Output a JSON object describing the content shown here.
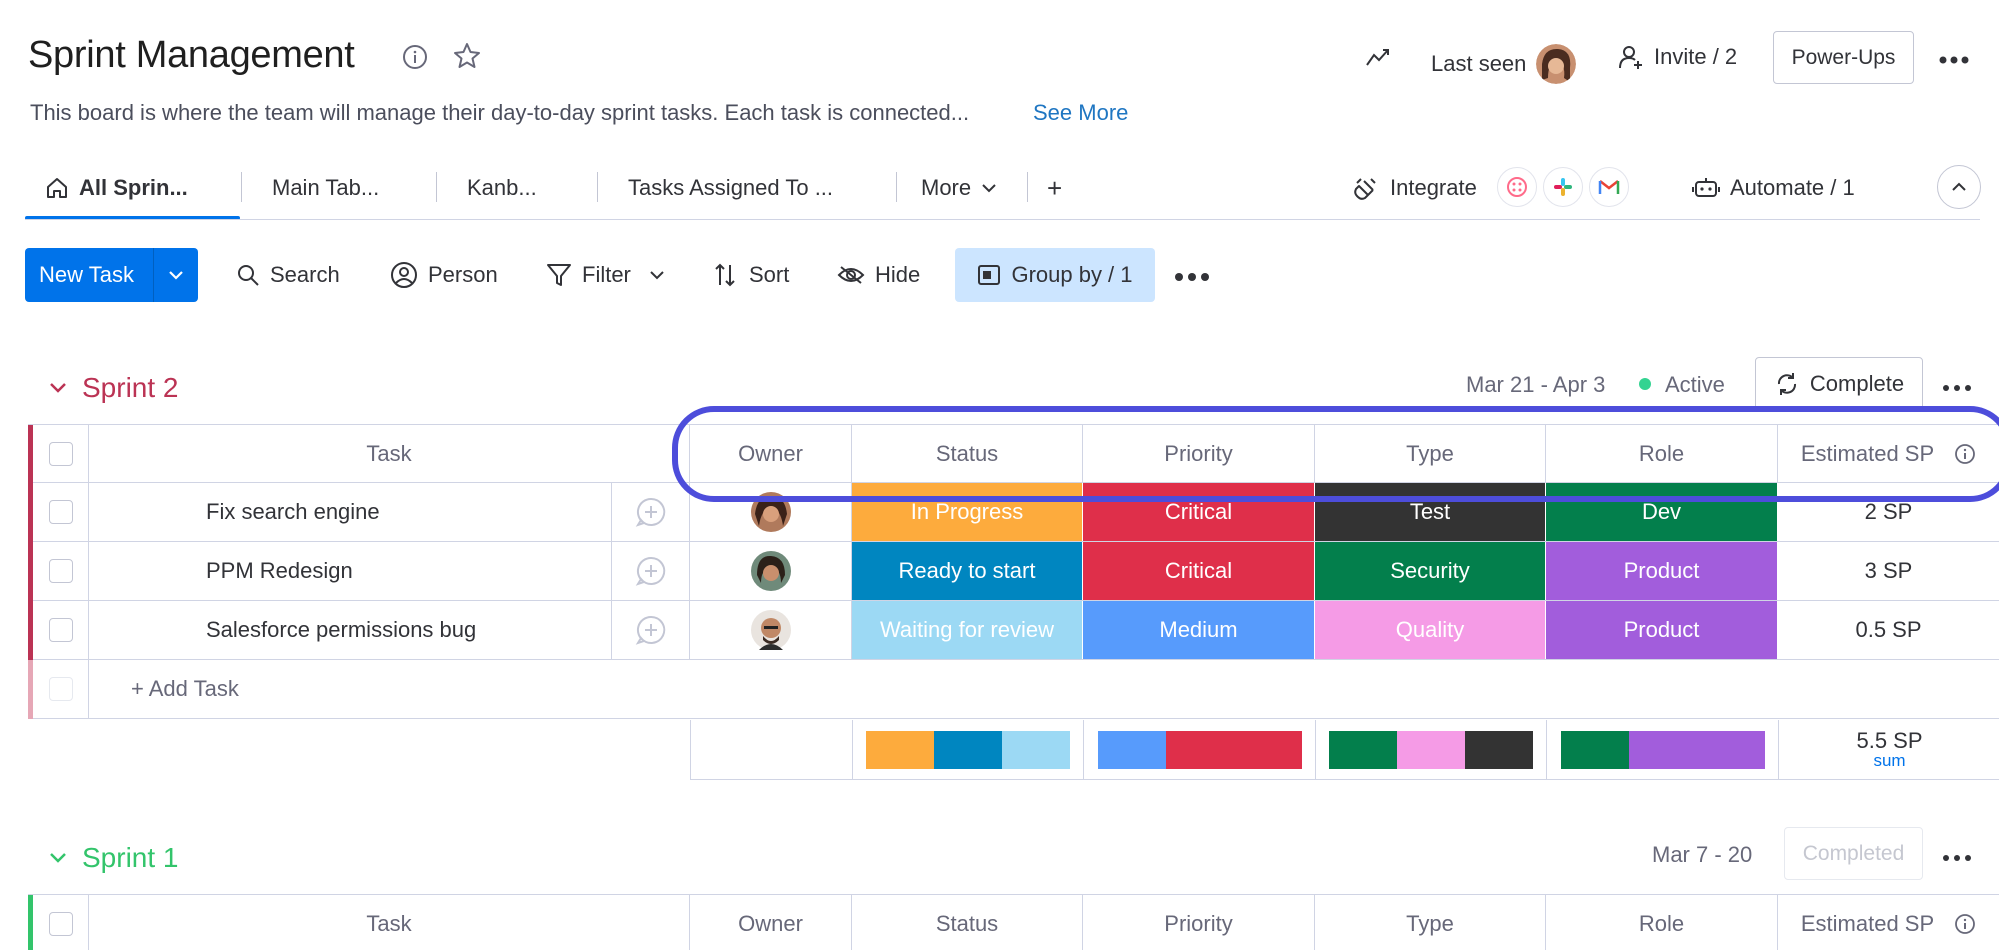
{
  "header": {
    "title": "Sprint Management",
    "description": "This board is where the team will manage their day-to-day sprint tasks. Each task is connected...",
    "see_more": "See More",
    "last_seen": "Last seen",
    "invite": "Invite / 2",
    "power_ups": "Power-Ups"
  },
  "tabs": {
    "items": [
      "All Sprin...",
      "Main Tab...",
      "Kanb...",
      "Tasks Assigned To ...",
      "More"
    ],
    "add": "+",
    "integrate": "Integrate",
    "automate": "Automate / 1"
  },
  "toolbar": {
    "new_task": "New Task",
    "search": "Search",
    "person": "Person",
    "filter": "Filter",
    "sort": "Sort",
    "hide": "Hide",
    "group_by": "Group by / 1"
  },
  "columns": [
    "Task",
    "Owner",
    "Status",
    "Priority",
    "Type",
    "Role",
    "Estimated SP"
  ],
  "groups": [
    {
      "name": "Sprint 2",
      "color": "#bb3354",
      "dates": "Mar 21 - Apr 3",
      "state": "Active",
      "action": "Complete",
      "rows": [
        {
          "task": "Fix search engine",
          "status": "In Progress",
          "status_color": "#fdab3d",
          "priority": "Critical",
          "priority_color": "#df2f4a",
          "type": "Test",
          "type_color": "#333333",
          "role": "Dev",
          "role_color": "#037f4c",
          "sp": "2 SP"
        },
        {
          "task": "PPM Redesign",
          "status": "Ready to start",
          "status_color": "#0086c0",
          "priority": "Critical",
          "priority_color": "#df2f4a",
          "type": "Security",
          "type_color": "#037f4c",
          "role": "Product",
          "role_color": "#a25ddc",
          "sp": "3 SP"
        },
        {
          "task": "Salesforce permissions bug",
          "status": "Waiting for review",
          "status_color": "#9cd9f4",
          "priority": "Medium",
          "priority_color": "#579bfc",
          "type": "Quality",
          "type_color": "#f59be6",
          "role": "Product",
          "role_color": "#a25ddc",
          "sp": "0.5 SP"
        }
      ],
      "add_task": "+ Add Task",
      "sum_value": "5.5 SP",
      "sum_label": "sum"
    },
    {
      "name": "Sprint 1",
      "color": "#33c46b",
      "dates": "Mar 7 - 20",
      "action": "Completed"
    }
  ]
}
